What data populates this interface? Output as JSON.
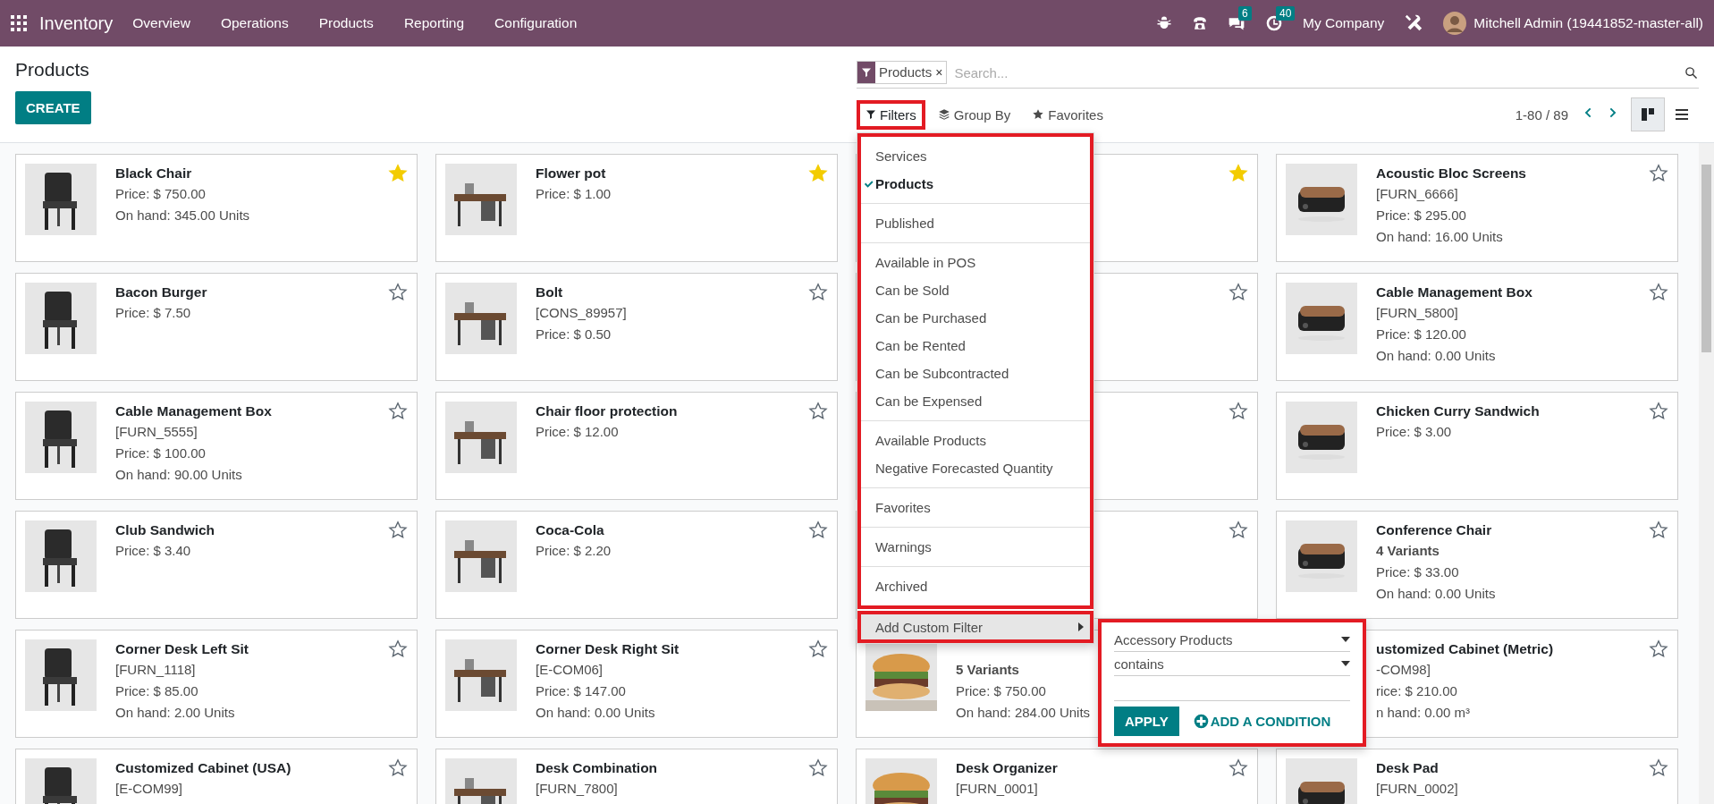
{
  "navbar": {
    "app": "Inventory",
    "menus": [
      "Overview",
      "Operations",
      "Products",
      "Reporting",
      "Configuration"
    ],
    "chat_badge": "6",
    "activity_badge": "40",
    "company": "My Company",
    "user": "Mitchell Admin (19441852-master-all)"
  },
  "title": "Products",
  "create": "CREATE",
  "search": {
    "facet": {
      "label": "Products",
      "remove": "×"
    },
    "placeholder": "Search..."
  },
  "filters": {
    "label": "Filters",
    "open": true,
    "groups": [
      {
        "items": [
          {
            "label": "Services",
            "selected": false
          },
          {
            "label": "Products",
            "selected": true
          }
        ]
      },
      {
        "items": [
          {
            "label": "Published",
            "selected": false
          }
        ]
      },
      {
        "items": [
          {
            "label": "Available in POS",
            "selected": false
          },
          {
            "label": "Can be Sold",
            "selected": false
          },
          {
            "label": "Can be Purchased",
            "selected": false
          },
          {
            "label": "Can be Rented",
            "selected": false
          },
          {
            "label": "Can be Subcontracted",
            "selected": false
          },
          {
            "label": "Can be Expensed",
            "selected": false
          }
        ]
      },
      {
        "items": [
          {
            "label": "Available Products",
            "selected": false
          },
          {
            "label": "Negative Forecasted Quantity",
            "selected": false
          }
        ]
      },
      {
        "items": [
          {
            "label": "Favorites",
            "selected": false
          }
        ]
      },
      {
        "items": [
          {
            "label": "Warnings",
            "selected": false
          }
        ]
      },
      {
        "items": [
          {
            "label": "Archived",
            "selected": false
          }
        ]
      }
    ],
    "custom": {
      "label": "Add Custom Filter",
      "expanded": true,
      "field": "Accessory Products",
      "operator": "contains",
      "apply": "APPLY",
      "add_condition": "ADD A CONDITION"
    }
  },
  "group_by": "Group By",
  "favorites": "Favorites",
  "pager": "1-80 / 89",
  "views": [
    {
      "kind": "kanban",
      "selected": true
    },
    {
      "kind": "list",
      "selected": false
    }
  ],
  "cards": [
    {
      "name": "Black Chair",
      "picture": true,
      "starred": true,
      "lines": [
        {
          "kind": "price",
          "text": "Price: $ 750.00"
        },
        {
          "kind": "onhand",
          "text": "On hand: 345.00 Units"
        }
      ]
    },
    {
      "name": "Flower pot",
      "picture": true,
      "starred": true,
      "lines": [
        {
          "kind": "price",
          "text": "Price: $ 1.00"
        }
      ]
    },
    {
      "starred": true
    },
    {
      "name": "Acoustic Bloc Screens",
      "picture": true,
      "starred": false,
      "lines": [
        {
          "kind": "code",
          "text": "[FURN_6666]"
        },
        {
          "kind": "price",
          "text": "Price: $ 295.00"
        },
        {
          "kind": "onhand",
          "text": "On hand: 16.00 Units"
        }
      ]
    },
    {
      "name": "Bacon Burger",
      "picture": true,
      "starred": false,
      "lines": [
        {
          "kind": "price",
          "text": "Price: $ 7.50"
        }
      ]
    },
    {
      "name": "Bolt",
      "picture": true,
      "starred": false,
      "lines": [
        {
          "kind": "code",
          "text": "[CONS_89957]"
        },
        {
          "kind": "price",
          "text": "Price: $ 0.50"
        }
      ]
    },
    {
      "starred": false
    },
    {
      "name": "Cable Management Box",
      "picture": true,
      "starred": false,
      "lines": [
        {
          "kind": "code",
          "text": "[FURN_5800]"
        },
        {
          "kind": "price",
          "text": "Price: $ 120.00"
        },
        {
          "kind": "onhand",
          "text": "On hand: 0.00 Units"
        }
      ]
    },
    {
      "name": "Cable Management Box",
      "picture": true,
      "starred": false,
      "lines": [
        {
          "kind": "code",
          "text": "[FURN_5555]"
        },
        {
          "kind": "price",
          "text": "Price: $ 100.00"
        },
        {
          "kind": "onhand",
          "text": "On hand: 90.00 Units"
        }
      ]
    },
    {
      "name": "Chair floor protection",
      "picture": true,
      "starred": false,
      "lines": [
        {
          "kind": "price",
          "text": "Price: $ 12.00"
        }
      ]
    },
    {
      "starred": false
    },
    {
      "name": "Chicken Curry Sandwich",
      "picture": true,
      "starred": false,
      "lines": [
        {
          "kind": "price",
          "text": "Price: $ 3.00"
        }
      ]
    },
    {
      "name": "Club Sandwich",
      "picture": true,
      "starred": false,
      "lines": [
        {
          "kind": "price",
          "text": "Price: $ 3.40"
        }
      ]
    },
    {
      "name": "Coca-Cola",
      "picture": true,
      "starred": false,
      "lines": [
        {
          "kind": "price",
          "text": "Price: $ 2.20"
        }
      ]
    },
    {
      "starred": false
    },
    {
      "name": "Conference Chair",
      "picture": true,
      "starred": false,
      "lines": [
        {
          "kind": "variants",
          "text": "4 Variants"
        },
        {
          "kind": "price",
          "text": "Price: $ 33.00"
        },
        {
          "kind": "onhand",
          "text": "On hand: 0.00 Units"
        }
      ]
    },
    {
      "name": "Corner Desk Left Sit",
      "picture": true,
      "starred": false,
      "lines": [
        {
          "kind": "code",
          "text": "[FURN_1118]"
        },
        {
          "kind": "price",
          "text": "Price: $ 85.00"
        },
        {
          "kind": "onhand",
          "text": "On hand: 2.00 Units"
        }
      ]
    },
    {
      "name": "Corner Desk Right Sit",
      "picture": true,
      "starred": false,
      "lines": [
        {
          "kind": "code",
          "text": "[E-COM06]"
        },
        {
          "kind": "price",
          "text": "Price: $ 147.00"
        },
        {
          "kind": "onhand",
          "text": "On hand: 0.00 Units"
        }
      ]
    },
    {
      "picture": true,
      "lines": [
        {
          "kind": "variants",
          "text": "5 Variants"
        },
        {
          "kind": "price",
          "text": "Price: $ 750.00"
        },
        {
          "kind": "onhand",
          "text": "On hand: 284.00 Units"
        }
      ]
    },
    {
      "name": "ustomized Cabinet (Metric)",
      "starred": false,
      "lines": [
        {
          "kind": "code",
          "text": "-COM98]"
        },
        {
          "kind": "price",
          "text": "rice: $ 210.00"
        },
        {
          "kind": "onhand",
          "text": "n hand: 0.00 m³"
        }
      ]
    },
    {
      "name": "Customized Cabinet (USA)",
      "picture": true,
      "starred": false,
      "lines": [
        {
          "kind": "code",
          "text": "[E-COM99]"
        }
      ]
    },
    {
      "name": "Desk Combination",
      "picture": true,
      "starred": false,
      "lines": [
        {
          "kind": "code",
          "text": "[FURN_7800]"
        }
      ]
    },
    {
      "name": "Desk Organizer",
      "picture": true,
      "starred": false,
      "lines": [
        {
          "kind": "code",
          "text": "[FURN_0001]"
        }
      ]
    },
    {
      "name": "Desk Pad",
      "picture": true,
      "starred": false,
      "lines": [
        {
          "kind": "code",
          "text": "[FURN_0002]"
        }
      ]
    }
  ]
}
